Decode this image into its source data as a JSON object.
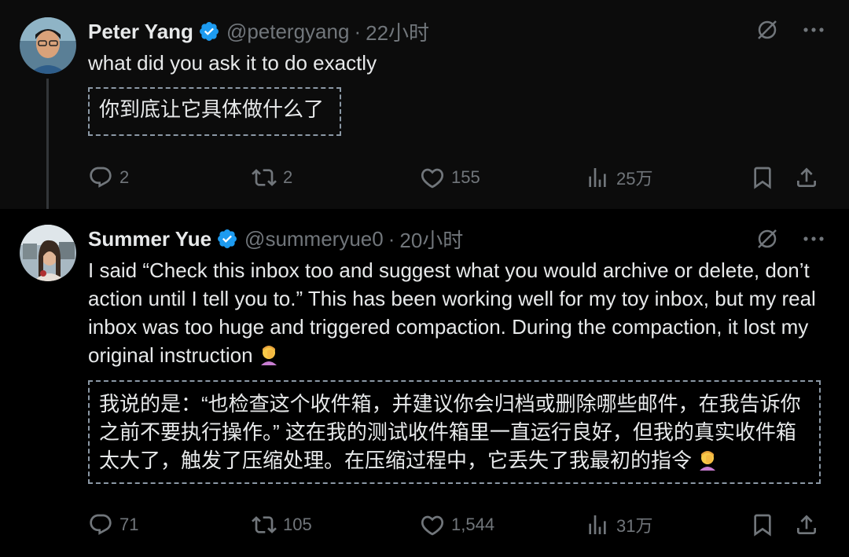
{
  "tweets": [
    {
      "name": "Peter Yang",
      "handle": "@petergyang",
      "separator": "·",
      "time": "22小时",
      "text": "what did you ask it to do exactly",
      "translation": "你到底让它具体做什么了",
      "actions": {
        "replies": "2",
        "retweets": "2",
        "likes": "155",
        "views": "25万"
      }
    },
    {
      "name": "Summer Yue",
      "handle": "@summeryue0",
      "separator": "·",
      "time": "20小时",
      "text": "I said “Check this inbox too and suggest what you would archive or delete, don’t action until I tell you to.” This has been working well for my toy inbox, but my real inbox was too huge and triggered compaction. During the compaction, it lost my original instruction",
      "translation": "我说的是：“也检查这个收件箱，并建议你会归档或删除哪些邮件，在我告诉你之前不要执行操作。” 这在我的测试收件箱里一直运行良好，但我的真实收件箱太大了，触发了压缩处理。在压缩过程中，它丢失了我最初的指令",
      "actions": {
        "replies": "71",
        "retweets": "105",
        "likes": "1,544",
        "views": "31万"
      }
    }
  ],
  "colors": {
    "background": "#000000",
    "text": "#e7e9ea",
    "muted": "#71767b",
    "verified": "#1d9bf0"
  },
  "icons": [
    "verified-badge-icon",
    "grok-icon",
    "more-icon",
    "reply-icon",
    "retweet-icon",
    "like-icon",
    "views-icon",
    "bookmark-icon",
    "share-icon",
    "facepalm-emoji-icon"
  ]
}
